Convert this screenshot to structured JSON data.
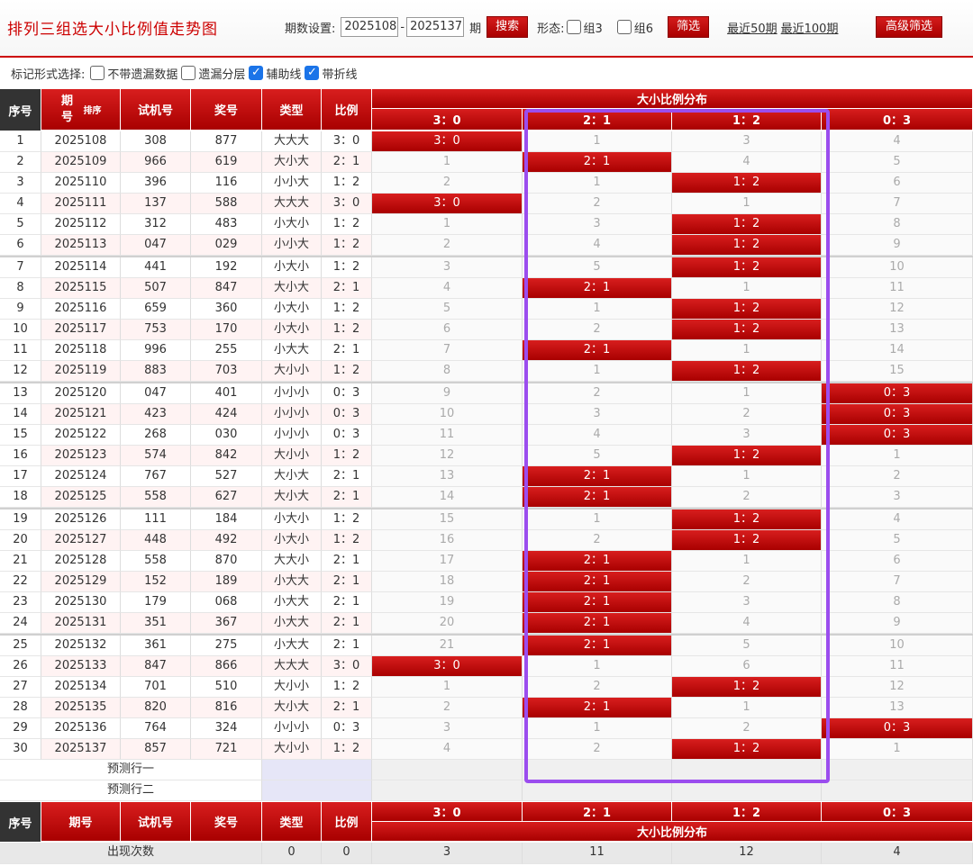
{
  "header": {
    "title": "排列三组选大小比例值走势图",
    "period_label": "期数设置:",
    "period_start": "2025108",
    "period_dash": "-",
    "period_end": "2025137",
    "period_unit": "期",
    "search_label": "搜索",
    "shape_label": "形态:",
    "group3_label": "组3",
    "group6_label": "组6",
    "filter_label": "筛选",
    "recent50_label": "最近50期",
    "recent100_label": "最近100期",
    "advanced_label": "高级筛选"
  },
  "options": {
    "label": "标记形式选择:",
    "items": [
      {
        "label": "不带遗漏数据",
        "checked": false
      },
      {
        "label": "遗漏分层",
        "checked": false
      },
      {
        "label": "辅助线",
        "checked": true
      },
      {
        "label": "带折线",
        "checked": true
      }
    ]
  },
  "table": {
    "headers": {
      "seq": "序号",
      "period": "期号",
      "sort": "排序",
      "test": "试机号",
      "draw": "奖号",
      "type": "类型",
      "ratio": "比例",
      "dist": "大小比例分布"
    },
    "dist_columns": [
      "3：0",
      "2：1",
      "1：2",
      "0：3"
    ],
    "rows": [
      {
        "seq": "1",
        "period": "2025108",
        "test": "308",
        "draw": "877",
        "type": "大大大",
        "ratio": "3：0",
        "dist": [
          "3：0",
          "1",
          "3",
          "4"
        ],
        "hit": 0
      },
      {
        "seq": "2",
        "period": "2025109",
        "test": "966",
        "draw": "619",
        "type": "大小大",
        "ratio": "2：1",
        "dist": [
          "1",
          "2：1",
          "4",
          "5"
        ],
        "hit": 1
      },
      {
        "seq": "3",
        "period": "2025110",
        "test": "396",
        "draw": "116",
        "type": "小小大",
        "ratio": "1：2",
        "dist": [
          "2",
          "1",
          "1：2",
          "6"
        ],
        "hit": 2
      },
      {
        "seq": "4",
        "period": "2025111",
        "test": "137",
        "draw": "588",
        "type": "大大大",
        "ratio": "3：0",
        "dist": [
          "3：0",
          "2",
          "1",
          "7"
        ],
        "hit": 0
      },
      {
        "seq": "5",
        "period": "2025112",
        "test": "312",
        "draw": "483",
        "type": "小大小",
        "ratio": "1：2",
        "dist": [
          "1",
          "3",
          "1：2",
          "8"
        ],
        "hit": 2
      },
      {
        "seq": "6",
        "period": "2025113",
        "test": "047",
        "draw": "029",
        "type": "小小大",
        "ratio": "1：2",
        "dist": [
          "2",
          "4",
          "1：2",
          "9"
        ],
        "hit": 2
      },
      {
        "seq": "7",
        "period": "2025114",
        "test": "441",
        "draw": "192",
        "type": "小大小",
        "ratio": "1：2",
        "dist": [
          "3",
          "5",
          "1：2",
          "10"
        ],
        "hit": 2
      },
      {
        "seq": "8",
        "period": "2025115",
        "test": "507",
        "draw": "847",
        "type": "大小大",
        "ratio": "2：1",
        "dist": [
          "4",
          "2：1",
          "1",
          "11"
        ],
        "hit": 1
      },
      {
        "seq": "9",
        "period": "2025116",
        "test": "659",
        "draw": "360",
        "type": "小大小",
        "ratio": "1：2",
        "dist": [
          "5",
          "1",
          "1：2",
          "12"
        ],
        "hit": 2
      },
      {
        "seq": "10",
        "period": "2025117",
        "test": "753",
        "draw": "170",
        "type": "小大小",
        "ratio": "1：2",
        "dist": [
          "6",
          "2",
          "1：2",
          "13"
        ],
        "hit": 2
      },
      {
        "seq": "11",
        "period": "2025118",
        "test": "996",
        "draw": "255",
        "type": "小大大",
        "ratio": "2：1",
        "dist": [
          "7",
          "2：1",
          "1",
          "14"
        ],
        "hit": 1
      },
      {
        "seq": "12",
        "period": "2025119",
        "test": "883",
        "draw": "703",
        "type": "大小小",
        "ratio": "1：2",
        "dist": [
          "8",
          "1",
          "1：2",
          "15"
        ],
        "hit": 2
      },
      {
        "seq": "13",
        "period": "2025120",
        "test": "047",
        "draw": "401",
        "type": "小小小",
        "ratio": "0：3",
        "dist": [
          "9",
          "2",
          "1",
          "0：3"
        ],
        "hit": 3
      },
      {
        "seq": "14",
        "period": "2025121",
        "test": "423",
        "draw": "424",
        "type": "小小小",
        "ratio": "0：3",
        "dist": [
          "10",
          "3",
          "2",
          "0：3"
        ],
        "hit": 3
      },
      {
        "seq": "15",
        "period": "2025122",
        "test": "268",
        "draw": "030",
        "type": "小小小",
        "ratio": "0：3",
        "dist": [
          "11",
          "4",
          "3",
          "0：3"
        ],
        "hit": 3
      },
      {
        "seq": "16",
        "period": "2025123",
        "test": "574",
        "draw": "842",
        "type": "大小小",
        "ratio": "1：2",
        "dist": [
          "12",
          "5",
          "1：2",
          "1"
        ],
        "hit": 2
      },
      {
        "seq": "17",
        "period": "2025124",
        "test": "767",
        "draw": "527",
        "type": "大小大",
        "ratio": "2：1",
        "dist": [
          "13",
          "2：1",
          "1",
          "2"
        ],
        "hit": 1
      },
      {
        "seq": "18",
        "period": "2025125",
        "test": "558",
        "draw": "627",
        "type": "大小大",
        "ratio": "2：1",
        "dist": [
          "14",
          "2：1",
          "2",
          "3"
        ],
        "hit": 1
      },
      {
        "seq": "19",
        "period": "2025126",
        "test": "111",
        "draw": "184",
        "type": "小大小",
        "ratio": "1：2",
        "dist": [
          "15",
          "1",
          "1：2",
          "4"
        ],
        "hit": 2
      },
      {
        "seq": "20",
        "period": "2025127",
        "test": "448",
        "draw": "492",
        "type": "小大小",
        "ratio": "1：2",
        "dist": [
          "16",
          "2",
          "1：2",
          "5"
        ],
        "hit": 2
      },
      {
        "seq": "21",
        "period": "2025128",
        "test": "558",
        "draw": "870",
        "type": "大大小",
        "ratio": "2：1",
        "dist": [
          "17",
          "2：1",
          "1",
          "6"
        ],
        "hit": 1
      },
      {
        "seq": "22",
        "period": "2025129",
        "test": "152",
        "draw": "189",
        "type": "小大大",
        "ratio": "2：1",
        "dist": [
          "18",
          "2：1",
          "2",
          "7"
        ],
        "hit": 1
      },
      {
        "seq": "23",
        "period": "2025130",
        "test": "179",
        "draw": "068",
        "type": "小大大",
        "ratio": "2：1",
        "dist": [
          "19",
          "2：1",
          "3",
          "8"
        ],
        "hit": 1
      },
      {
        "seq": "24",
        "period": "2025131",
        "test": "351",
        "draw": "367",
        "type": "小大大",
        "ratio": "2：1",
        "dist": [
          "20",
          "2：1",
          "4",
          "9"
        ],
        "hit": 1
      },
      {
        "seq": "25",
        "period": "2025132",
        "test": "361",
        "draw": "275",
        "type": "小大大",
        "ratio": "2：1",
        "dist": [
          "21",
          "2：1",
          "5",
          "10"
        ],
        "hit": 1
      },
      {
        "seq": "26",
        "period": "2025133",
        "test": "847",
        "draw": "866",
        "type": "大大大",
        "ratio": "3：0",
        "dist": [
          "3：0",
          "1",
          "6",
          "11"
        ],
        "hit": 0
      },
      {
        "seq": "27",
        "period": "2025134",
        "test": "701",
        "draw": "510",
        "type": "大小小",
        "ratio": "1：2",
        "dist": [
          "1",
          "2",
          "1：2",
          "12"
        ],
        "hit": 2
      },
      {
        "seq": "28",
        "period": "2025135",
        "test": "820",
        "draw": "816",
        "type": "大小大",
        "ratio": "2：1",
        "dist": [
          "2",
          "2：1",
          "1",
          "13"
        ],
        "hit": 1
      },
      {
        "seq": "29",
        "period": "2025136",
        "test": "764",
        "draw": "324",
        "type": "小小小",
        "ratio": "0：3",
        "dist": [
          "3",
          "1",
          "2",
          "0：3"
        ],
        "hit": 3
      },
      {
        "seq": "30",
        "period": "2025137",
        "test": "857",
        "draw": "721",
        "type": "大小小",
        "ratio": "1：2",
        "dist": [
          "4",
          "2",
          "1：2",
          "1"
        ],
        "hit": 2
      }
    ],
    "predict_rows": [
      "预测行一",
      "预测行二"
    ],
    "footer": {
      "label": "出现次数",
      "type_count": "0",
      "ratio_count": "0",
      "dist_counts": [
        "3",
        "11",
        "12",
        "4"
      ]
    }
  },
  "colors": {
    "accent": "#c00000",
    "highlight_box": "#9b4dee",
    "checkbox": "#1b74e8"
  }
}
